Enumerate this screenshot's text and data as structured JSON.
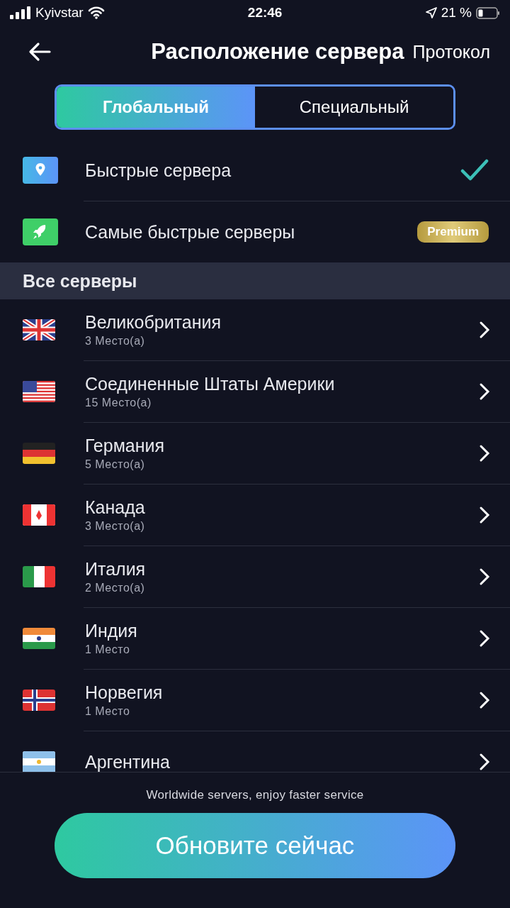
{
  "status_bar": {
    "carrier": "Kyivstar",
    "time": "22:46",
    "battery": "21 %"
  },
  "header": {
    "title": "Расположение сервера",
    "action": "Протокол"
  },
  "tabs": [
    {
      "label": "Глобальный",
      "selected": true
    },
    {
      "label": "Специальный",
      "selected": false
    }
  ],
  "quick_options": [
    {
      "kind": "location",
      "label": "Быстрые сервера",
      "selected": true
    },
    {
      "kind": "rocket",
      "label": "Самые быстрые серверы",
      "selected": false,
      "badge": "Premium"
    }
  ],
  "section_title": "Все серверы",
  "countries": [
    {
      "kind": "uk",
      "name": "Великобритания",
      "count": "3 Место(а)"
    },
    {
      "kind": "us",
      "name": "Соединенные Штаты Америки",
      "count": "15 Место(а)"
    },
    {
      "kind": "de",
      "name": "Германия",
      "count": "5 Место(а)"
    },
    {
      "kind": "ca",
      "name": "Канада",
      "count": "3 Место(а)"
    },
    {
      "kind": "it",
      "name": "Италия",
      "count": "2 Место(а)"
    },
    {
      "kind": "in",
      "name": "Индия",
      "count": "1 Место"
    },
    {
      "kind": "no",
      "name": "Норвегия",
      "count": "1 Место"
    },
    {
      "kind": "ar",
      "name": "Аргентина"
    }
  ],
  "footer": {
    "note": "Worldwide servers, enjoy faster service",
    "button": "Обновите сейчас"
  }
}
